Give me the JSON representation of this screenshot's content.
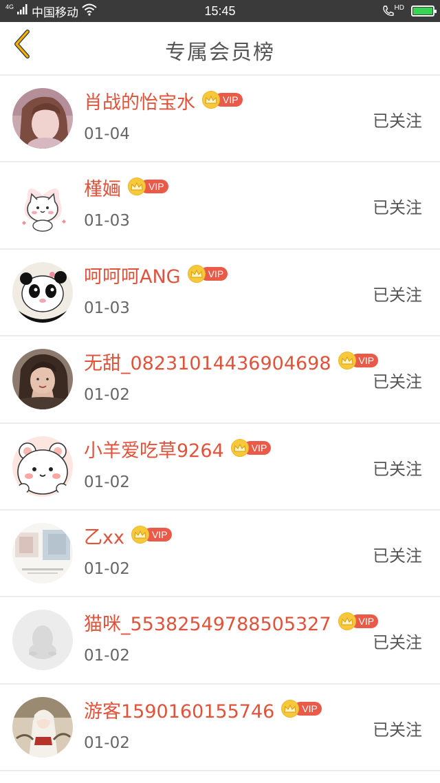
{
  "status_bar": {
    "network_type": "4G",
    "carrier": "中国移动",
    "time": "15:45",
    "hd_label": "HD",
    "battery_color": "#39d353"
  },
  "nav": {
    "title": "专属会员榜",
    "back_icon": "chevron-left-icon",
    "back_color": "#f0b400"
  },
  "members": [
    {
      "name": "肖战的怡宝水",
      "vip_label": "VIP",
      "date": "01-04",
      "follow_label": "已关注",
      "avatar": "girl-photo"
    },
    {
      "name": "槿婳",
      "vip_label": "VIP",
      "date": "01-03",
      "follow_label": "已关注",
      "avatar": "cartoon-cat"
    },
    {
      "name": "呵呵呵ANG",
      "vip_label": "VIP",
      "date": "01-03",
      "follow_label": "已关注",
      "avatar": "cartoon-panda"
    },
    {
      "name": "无甜_08231014436904698",
      "vip_label": "VIP",
      "date": "01-02",
      "follow_label": "已关注",
      "avatar": "girl-photo"
    },
    {
      "name": "小羊爱吃草9264",
      "vip_label": "VIP",
      "date": "01-02",
      "follow_label": "已关注",
      "avatar": "cartoon-bear"
    },
    {
      "name": "乙xx",
      "vip_label": "VIP",
      "date": "01-02",
      "follow_label": "已关注",
      "avatar": "blurred-photo"
    },
    {
      "name": "猫咪_55382549788505327",
      "vip_label": "VIP",
      "date": "01-02",
      "follow_label": "已关注",
      "avatar": "default-penguin"
    },
    {
      "name": "游客1590160155746",
      "vip_label": "VIP",
      "date": "01-02",
      "follow_label": "已关注",
      "avatar": "anime-illustration"
    }
  ],
  "colors": {
    "name": "#e0533a",
    "vip_pill": "#ea5a48",
    "vip_crown": "#f6c93a"
  }
}
